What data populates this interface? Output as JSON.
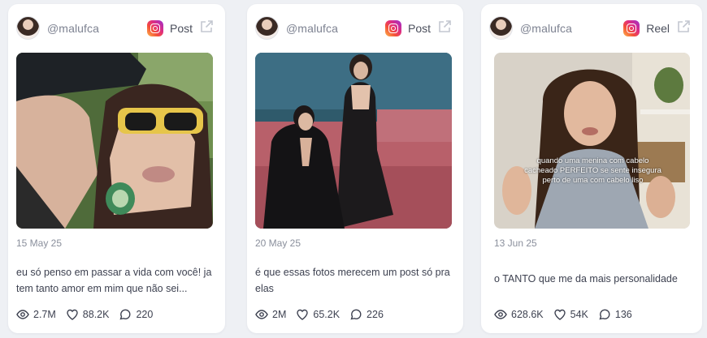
{
  "cards": [
    {
      "handle": "@malufca",
      "platform": "Post",
      "platform_icon": "instagram-icon",
      "date": "15 May 25",
      "caption": "eu só penso em passar a vida com você! ja tem tanto amor em mim que não sei...",
      "stats": {
        "views": "2.7M",
        "likes": "88.2K",
        "comments": "220"
      }
    },
    {
      "handle": "@malufca",
      "platform": "Post",
      "platform_icon": "instagram-icon",
      "date": "20 May 25",
      "caption": "é que essas fotos merecem um post só pra elas",
      "stats": {
        "views": "2M",
        "likes": "65.2K",
        "comments": "226"
      }
    },
    {
      "handle": "@malufca",
      "platform": "Reel",
      "platform_icon": "instagram-icon",
      "date": "13 Jun 25",
      "caption": "o TANTO que me da mais personalidade",
      "overlay_text": "quando uma menina com cabelo cacheado PERFEITO se sente insegura perto de uma com cabelo liso",
      "stats": {
        "views": "628.6K",
        "likes": "54K",
        "comments": "136"
      }
    }
  ],
  "colors": {
    "card_bg": "#ffffff",
    "page_bg": "#eef0f4",
    "muted": "#8a8f9c"
  }
}
